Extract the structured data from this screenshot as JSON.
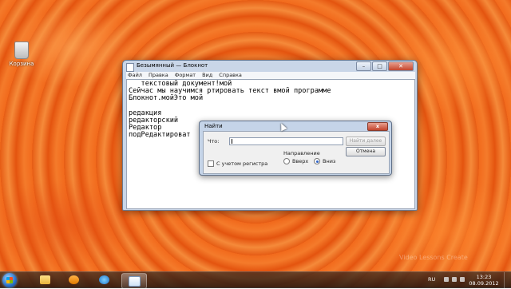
{
  "desktop": {
    "recycle_bin_label": "Корзина",
    "watermark": "Video Lessons Create"
  },
  "notepad": {
    "title": "Безымянный — Блокнот",
    "menu": [
      "Файл",
      "Правка",
      "Формат",
      "Вид",
      "Справка"
    ],
    "lines": [
      "   текстовый документ!мой",
      "Сейчас мы научимся ртировать текст вмой программе",
      "Блокнот.мойЭто мой",
      "",
      "редакция",
      "редакторский",
      "Редактор",
      "подРедактироват"
    ]
  },
  "find_dialog": {
    "title": "Найти",
    "close_label": "x",
    "what_label": "Что:",
    "search_value": "",
    "find_next_label": "Найти далее",
    "cancel_label": "Отмена",
    "direction_label": "Направление",
    "up_label": "Вверх",
    "down_label": "Вниз",
    "selected_direction": "down",
    "match_case_label": "С учетом регистра",
    "match_case_checked": false
  },
  "taskbar": {
    "apps": [
      "folder-icon",
      "media-player-icon",
      "internet-explorer-icon",
      "notepad-icon"
    ],
    "active_app": "notepad-icon",
    "language": "RU",
    "time": "13:23",
    "date": "08.09.2012"
  }
}
